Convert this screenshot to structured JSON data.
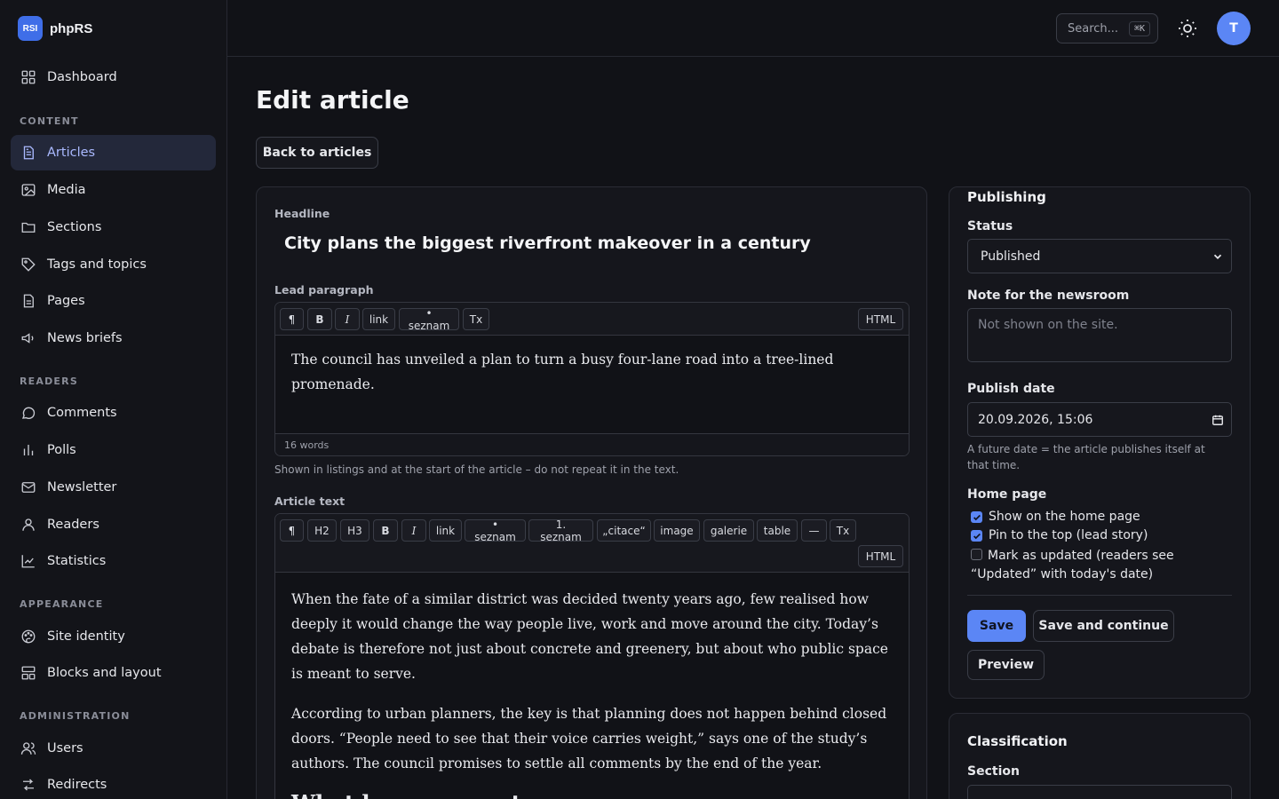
{
  "brand": {
    "logo_text": "RSI",
    "name": "phpRS"
  },
  "sidebar": {
    "dashboard": "Dashboard",
    "groups": {
      "content": "CONTENT",
      "readers": "READERS",
      "appearance": "APPEARANCE",
      "administration": "ADMINISTRATION"
    },
    "items": {
      "articles": "Articles",
      "media": "Media",
      "sections": "Sections",
      "tags": "Tags and topics",
      "pages": "Pages",
      "news_briefs": "News briefs",
      "comments": "Comments",
      "polls": "Polls",
      "newsletter": "Newsletter",
      "readers": "Readers",
      "statistics": "Statistics",
      "site_identity": "Site identity",
      "blocks_layout": "Blocks and layout",
      "users": "Users",
      "redirects": "Redirects"
    }
  },
  "topbar": {
    "search_placeholder": "Search...",
    "search_shortcut": "⌘K",
    "avatar_initial": "T"
  },
  "page": {
    "title": "Edit article",
    "back_button": "Back to articles"
  },
  "editor": {
    "headline_label": "Headline",
    "headline": "City plans the biggest riverfront makeover in a century",
    "lead_label": "Lead paragraph",
    "lead_toolbar": [
      "¶",
      "B",
      "I",
      "link",
      "• seznam",
      "Tx"
    ],
    "html_toggle": "HTML",
    "lead_text": "The council has unveiled a plan to turn a busy four-lane road into a tree-lined promenade.",
    "lead_word_count": "16 words",
    "lead_hint": "Shown in listings and at the start of the article – do not repeat it in the text.",
    "text_label": "Article text",
    "text_toolbar": [
      "¶",
      "H2",
      "H3",
      "B",
      "I",
      "link",
      "• seznam",
      "1. seznam",
      "„citace“",
      "image",
      "galerie",
      "table",
      "—",
      "Tx"
    ],
    "body": {
      "p1": "When the fate of a similar district was decided twenty years ago, few realised how deeply it would change the way people live, work and move around the city. Today’s debate is therefore not just about concrete and greenery, but about who public space is meant to serve.",
      "p2": "According to urban planners, the key is that planning does not happen behind closed doors. “People need to see that their voice carries weight,” says one of the study’s authors. The council promises to settle all comments by the end of the year.",
      "h2": "What happens next"
    }
  },
  "publishing": {
    "title": "Publishing",
    "status_label": "Status",
    "status_value": "Published",
    "note_label": "Note for the newsroom",
    "note_placeholder": "Not shown on the site.",
    "date_label": "Publish date",
    "date_value": "20.09.2026, 15:06",
    "date_hint": "A future date = the article publishes itself at that time.",
    "home_label": "Home page",
    "checks": {
      "show_home": "Show on the home page",
      "pin_top": "Pin to the top (lead story)",
      "mark_updated": "Mark as updated (readers see “Updated” with today's date)"
    },
    "save": "Save",
    "save_continue": "Save and continue",
    "preview": "Preview"
  },
  "classification": {
    "title": "Classification",
    "section_label": "Section"
  },
  "colors": {
    "accent": "#5b86f5",
    "active_nav_bg": "#23283a",
    "background": "#111217"
  }
}
